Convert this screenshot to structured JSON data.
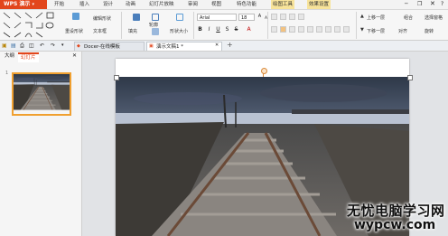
{
  "app": {
    "brand": "WPS 演示"
  },
  "menu": [
    "开始",
    "插入",
    "设计",
    "动画",
    "幻灯片放映",
    "审阅",
    "视图",
    "特色功能",
    "绘图工具",
    "效果设置"
  ],
  "ribbon": {
    "reset_label": "重设形状",
    "text_box_label": "文本框",
    "edit_shape_label": "编辑形状",
    "fill_label": "填充",
    "outline_label": "轮廓",
    "shape_effect_label": "形状效果",
    "size_label": "形状大小",
    "font_name": "Arial",
    "font_size": "18",
    "up_layer_label": "上移一层",
    "down_layer_label": "下移一层",
    "align_label": "对齐",
    "group_label": "组合",
    "select_label": "选择窗格",
    "rotate_label": "旋转"
  },
  "tabs": [
    {
      "label": "Docer-在线模板"
    },
    {
      "label": "演示文稿1 *"
    }
  ],
  "left_panel": {
    "outline_tab": "大纲",
    "slides_tab": "幻灯片",
    "slide_number": "1"
  },
  "watermark": {
    "line1": "无忧电脑学习网",
    "line2": "wypcw.com"
  },
  "colors": {
    "brand": "#e2461c",
    "highlight_tab": "#f7e39a",
    "thumb_border": "#f0a030"
  }
}
